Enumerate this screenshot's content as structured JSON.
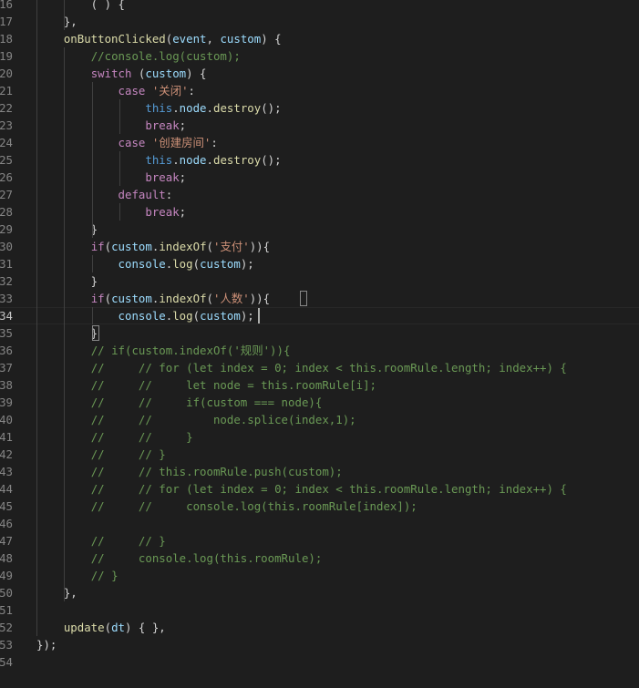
{
  "editor": {
    "background": "#1e1e1e",
    "active_line": "34",
    "lines": [
      {
        "n": "16",
        "tokens": [
          [
            "pl",
            "        ( ) {"
          ]
        ]
      },
      {
        "n": "17",
        "tokens": [
          [
            "pl",
            "    },"
          ]
        ]
      },
      {
        "n": "18",
        "tokens": [
          [
            "pl",
            "    "
          ],
          [
            "fn",
            "onButtonClicked"
          ],
          [
            "pl",
            "("
          ],
          [
            "var",
            "event"
          ],
          [
            "pl",
            ", "
          ],
          [
            "var",
            "custom"
          ],
          [
            "pl",
            ") {"
          ]
        ]
      },
      {
        "n": "19",
        "tokens": [
          [
            "pl",
            "        "
          ],
          [
            "cm",
            "//console.log(custom);"
          ]
        ]
      },
      {
        "n": "20",
        "tokens": [
          [
            "pl",
            "        "
          ],
          [
            "kw",
            "switch"
          ],
          [
            "pl",
            " ("
          ],
          [
            "var",
            "custom"
          ],
          [
            "pl",
            ") {"
          ]
        ]
      },
      {
        "n": "21",
        "tokens": [
          [
            "pl",
            "            "
          ],
          [
            "kw",
            "case"
          ],
          [
            "pl",
            " "
          ],
          [
            "str",
            "'关闭'"
          ],
          [
            "pl",
            ":"
          ]
        ]
      },
      {
        "n": "22",
        "tokens": [
          [
            "pl",
            "                "
          ],
          [
            "key",
            "this"
          ],
          [
            "pl",
            "."
          ],
          [
            "var",
            "node"
          ],
          [
            "pl",
            "."
          ],
          [
            "fn",
            "destroy"
          ],
          [
            "pl",
            "();"
          ]
        ]
      },
      {
        "n": "23",
        "tokens": [
          [
            "pl",
            "                "
          ],
          [
            "kw",
            "break"
          ],
          [
            "pl",
            ";"
          ]
        ]
      },
      {
        "n": "24",
        "tokens": [
          [
            "pl",
            "            "
          ],
          [
            "kw",
            "case"
          ],
          [
            "pl",
            " "
          ],
          [
            "str",
            "'创建房间'"
          ],
          [
            "pl",
            ":"
          ]
        ]
      },
      {
        "n": "25",
        "tokens": [
          [
            "pl",
            "                "
          ],
          [
            "key",
            "this"
          ],
          [
            "pl",
            "."
          ],
          [
            "var",
            "node"
          ],
          [
            "pl",
            "."
          ],
          [
            "fn",
            "destroy"
          ],
          [
            "pl",
            "();"
          ]
        ]
      },
      {
        "n": "26",
        "tokens": [
          [
            "pl",
            "                "
          ],
          [
            "kw",
            "break"
          ],
          [
            "pl",
            ";"
          ]
        ]
      },
      {
        "n": "27",
        "tokens": [
          [
            "pl",
            "            "
          ],
          [
            "kw",
            "default"
          ],
          [
            "pl",
            ":"
          ]
        ]
      },
      {
        "n": "28",
        "tokens": [
          [
            "pl",
            "                "
          ],
          [
            "kw",
            "break"
          ],
          [
            "pl",
            ";"
          ]
        ]
      },
      {
        "n": "29",
        "tokens": [
          [
            "pl",
            "        }"
          ]
        ]
      },
      {
        "n": "30",
        "tokens": [
          [
            "pl",
            "        "
          ],
          [
            "kw",
            "if"
          ],
          [
            "pl",
            "("
          ],
          [
            "var",
            "custom"
          ],
          [
            "pl",
            "."
          ],
          [
            "fn",
            "indexOf"
          ],
          [
            "pl",
            "("
          ],
          [
            "str",
            "'支付'"
          ],
          [
            "pl",
            ")){"
          ]
        ]
      },
      {
        "n": "31",
        "tokens": [
          [
            "pl",
            "            "
          ],
          [
            "var",
            "console"
          ],
          [
            "pl",
            "."
          ],
          [
            "fn",
            "log"
          ],
          [
            "pl",
            "("
          ],
          [
            "var",
            "custom"
          ],
          [
            "pl",
            ");"
          ]
        ]
      },
      {
        "n": "32",
        "tokens": [
          [
            "pl",
            "        }"
          ]
        ]
      },
      {
        "n": "33",
        "tokens": [
          [
            "pl",
            "        "
          ],
          [
            "kw",
            "if"
          ],
          [
            "pl",
            "("
          ],
          [
            "var",
            "custom"
          ],
          [
            "pl",
            "."
          ],
          [
            "fn",
            "indexOf"
          ],
          [
            "pl",
            "("
          ],
          [
            "str",
            "'人数'"
          ],
          [
            "pl",
            ")){"
          ]
        ]
      },
      {
        "n": "34",
        "tokens": [
          [
            "pl",
            "            "
          ],
          [
            "var",
            "console"
          ],
          [
            "pl",
            "."
          ],
          [
            "fn",
            "log"
          ],
          [
            "pl",
            "("
          ],
          [
            "var",
            "custom"
          ],
          [
            "pl",
            ");"
          ]
        ]
      },
      {
        "n": "35",
        "tokens": [
          [
            "pl",
            "        }"
          ]
        ]
      },
      {
        "n": "36",
        "tokens": [
          [
            "pl",
            "        "
          ],
          [
            "cm",
            "// if(custom.indexOf('规则')){"
          ]
        ]
      },
      {
        "n": "37",
        "tokens": [
          [
            "pl",
            "        "
          ],
          [
            "cm",
            "//     // for (let index = 0; index < this.roomRule.length; index++) {"
          ]
        ]
      },
      {
        "n": "38",
        "tokens": [
          [
            "pl",
            "        "
          ],
          [
            "cm",
            "//     //     let node = this.roomRule[i];"
          ]
        ]
      },
      {
        "n": "39",
        "tokens": [
          [
            "pl",
            "        "
          ],
          [
            "cm",
            "//     //     if(custom === node){"
          ]
        ]
      },
      {
        "n": "40",
        "tokens": [
          [
            "pl",
            "        "
          ],
          [
            "cm",
            "//     //         node.splice(index,1);"
          ]
        ]
      },
      {
        "n": "41",
        "tokens": [
          [
            "pl",
            "        "
          ],
          [
            "cm",
            "//     //     }"
          ]
        ]
      },
      {
        "n": "42",
        "tokens": [
          [
            "pl",
            "        "
          ],
          [
            "cm",
            "//     // }"
          ]
        ]
      },
      {
        "n": "43",
        "tokens": [
          [
            "pl",
            "        "
          ],
          [
            "cm",
            "//     // this.roomRule.push(custom);"
          ]
        ]
      },
      {
        "n": "44",
        "tokens": [
          [
            "pl",
            "        "
          ],
          [
            "cm",
            "//     // for (let index = 0; index < this.roomRule.length; index++) {"
          ]
        ]
      },
      {
        "n": "45",
        "tokens": [
          [
            "pl",
            "        "
          ],
          [
            "cm",
            "//     //     console.log(this.roomRule[index]);"
          ]
        ]
      },
      {
        "n": "46",
        "tokens": []
      },
      {
        "n": "47",
        "tokens": [
          [
            "pl",
            "        "
          ],
          [
            "cm",
            "//     // }"
          ]
        ]
      },
      {
        "n": "48",
        "tokens": [
          [
            "pl",
            "        "
          ],
          [
            "cm",
            "//     console.log(this.roomRule);"
          ]
        ]
      },
      {
        "n": "49",
        "tokens": [
          [
            "pl",
            "        "
          ],
          [
            "cm",
            "// }"
          ]
        ]
      },
      {
        "n": "50",
        "tokens": [
          [
            "pl",
            "    },"
          ]
        ]
      },
      {
        "n": "51",
        "tokens": []
      },
      {
        "n": "52",
        "tokens": [
          [
            "pl",
            "    "
          ],
          [
            "fn",
            "update"
          ],
          [
            "pl",
            "("
          ],
          [
            "var",
            "dt"
          ],
          [
            "pl",
            ") { },"
          ]
        ]
      },
      {
        "n": "53",
        "tokens": [
          [
            "pl",
            "});"
          ]
        ]
      },
      {
        "n": "54",
        "tokens": []
      }
    ]
  },
  "colors": {
    "keyword": "#c586c0",
    "this_keyword": "#569cd6",
    "function": "#dcdcaa",
    "variable": "#9cdcfe",
    "string": "#ce9178",
    "comment": "#6a9955",
    "plain": "#d4d4d4",
    "line_number": "#858585",
    "line_number_active": "#c6c6c6"
  }
}
